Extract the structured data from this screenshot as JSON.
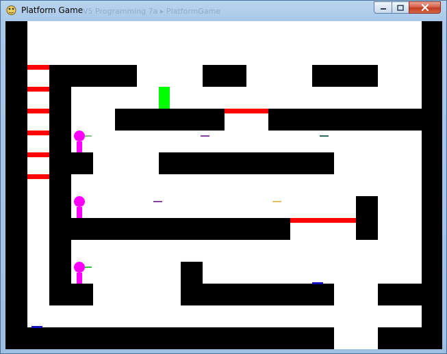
{
  "window": {
    "title": "Platform Game",
    "background_title_ghost": "V5 Programming 7a  ▸  PlatformGame",
    "buttons": {
      "minimize": "minimize",
      "maximize": "maximize",
      "close": "close"
    },
    "app_icon": "pygame-snake-icon"
  },
  "colors": {
    "wall": "#000000",
    "ladder": "#ff0000",
    "goal": "#00ff00",
    "player": "#ff00ff",
    "purple_item": "#8040a0",
    "teal_item": "#2a6a5a",
    "gold_item": "#e0c060",
    "blue_item": "#1010c0"
  }
}
